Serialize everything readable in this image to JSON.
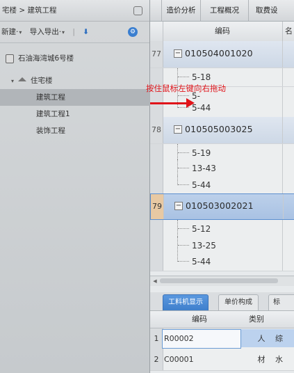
{
  "breadcrumb": "宅楼 > 建筑工程",
  "toolbar": {
    "new_label": "新建·",
    "import_export_label": "导入导出·"
  },
  "tree": {
    "project": "石油海湾城6号楼",
    "group": "住宅楼",
    "items": [
      "建筑工程",
      "建筑工程1",
      "装饰工程"
    ]
  },
  "tabs": [
    "造价分析",
    "工程概况",
    "取费设"
  ],
  "grid": {
    "header_code": "编码",
    "header_partial": "名",
    "rows": [
      {
        "num": "77",
        "code": "010504001020",
        "subs": [
          "5-18",
          "5-",
          "5-44"
        ]
      },
      {
        "num": "78",
        "code": "010505003025",
        "subs": [
          "5-19",
          "13-43",
          "5-44"
        ]
      },
      {
        "num": "79",
        "code": "010503002021",
        "subs": [
          "5-12",
          "13-25",
          "5-44"
        ]
      }
    ]
  },
  "bottom": {
    "tabs": [
      "工料机显示",
      "单价构成",
      "标"
    ],
    "header_code": "编码",
    "header_type": "类别",
    "rows": [
      {
        "num": "1",
        "code": "R00002",
        "type": "人",
        "name": "综"
      },
      {
        "num": "2",
        "code": "C00001",
        "type": "材",
        "name": "水"
      }
    ]
  },
  "annotation": "按住鼠标左键向右拖动",
  "colors": {
    "annotation": "#e0141a",
    "selected_row": "#a9c2e3",
    "active_tab": "#3f7fcc"
  }
}
